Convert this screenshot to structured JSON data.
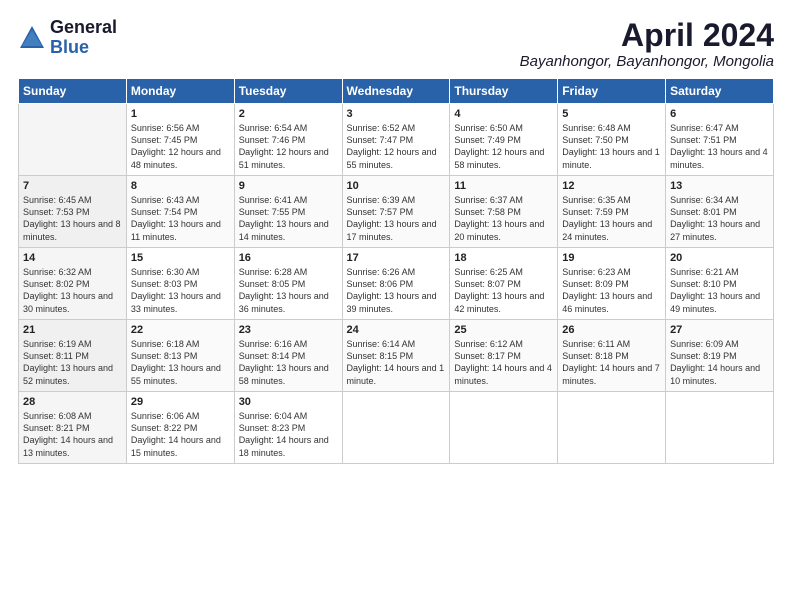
{
  "logo": {
    "general": "General",
    "blue": "Blue"
  },
  "title": "April 2024",
  "location": "Bayanhongor, Bayanhongor, Mongolia",
  "headers": [
    "Sunday",
    "Monday",
    "Tuesday",
    "Wednesday",
    "Thursday",
    "Friday",
    "Saturday"
  ],
  "weeks": [
    [
      {
        "day": "",
        "content": ""
      },
      {
        "day": "1",
        "content": "Sunrise: 6:56 AM\nSunset: 7:45 PM\nDaylight: 12 hours\nand 48 minutes."
      },
      {
        "day": "2",
        "content": "Sunrise: 6:54 AM\nSunset: 7:46 PM\nDaylight: 12 hours\nand 51 minutes."
      },
      {
        "day": "3",
        "content": "Sunrise: 6:52 AM\nSunset: 7:47 PM\nDaylight: 12 hours\nand 55 minutes."
      },
      {
        "day": "4",
        "content": "Sunrise: 6:50 AM\nSunset: 7:49 PM\nDaylight: 12 hours\nand 58 minutes."
      },
      {
        "day": "5",
        "content": "Sunrise: 6:48 AM\nSunset: 7:50 PM\nDaylight: 13 hours\nand 1 minute."
      },
      {
        "day": "6",
        "content": "Sunrise: 6:47 AM\nSunset: 7:51 PM\nDaylight: 13 hours\nand 4 minutes."
      }
    ],
    [
      {
        "day": "7",
        "content": "Sunrise: 6:45 AM\nSunset: 7:53 PM\nDaylight: 13 hours\nand 8 minutes."
      },
      {
        "day": "8",
        "content": "Sunrise: 6:43 AM\nSunset: 7:54 PM\nDaylight: 13 hours\nand 11 minutes."
      },
      {
        "day": "9",
        "content": "Sunrise: 6:41 AM\nSunset: 7:55 PM\nDaylight: 13 hours\nand 14 minutes."
      },
      {
        "day": "10",
        "content": "Sunrise: 6:39 AM\nSunset: 7:57 PM\nDaylight: 13 hours\nand 17 minutes."
      },
      {
        "day": "11",
        "content": "Sunrise: 6:37 AM\nSunset: 7:58 PM\nDaylight: 13 hours\nand 20 minutes."
      },
      {
        "day": "12",
        "content": "Sunrise: 6:35 AM\nSunset: 7:59 PM\nDaylight: 13 hours\nand 24 minutes."
      },
      {
        "day": "13",
        "content": "Sunrise: 6:34 AM\nSunset: 8:01 PM\nDaylight: 13 hours\nand 27 minutes."
      }
    ],
    [
      {
        "day": "14",
        "content": "Sunrise: 6:32 AM\nSunset: 8:02 PM\nDaylight: 13 hours\nand 30 minutes."
      },
      {
        "day": "15",
        "content": "Sunrise: 6:30 AM\nSunset: 8:03 PM\nDaylight: 13 hours\nand 33 minutes."
      },
      {
        "day": "16",
        "content": "Sunrise: 6:28 AM\nSunset: 8:05 PM\nDaylight: 13 hours\nand 36 minutes."
      },
      {
        "day": "17",
        "content": "Sunrise: 6:26 AM\nSunset: 8:06 PM\nDaylight: 13 hours\nand 39 minutes."
      },
      {
        "day": "18",
        "content": "Sunrise: 6:25 AM\nSunset: 8:07 PM\nDaylight: 13 hours\nand 42 minutes."
      },
      {
        "day": "19",
        "content": "Sunrise: 6:23 AM\nSunset: 8:09 PM\nDaylight: 13 hours\nand 46 minutes."
      },
      {
        "day": "20",
        "content": "Sunrise: 6:21 AM\nSunset: 8:10 PM\nDaylight: 13 hours\nand 49 minutes."
      }
    ],
    [
      {
        "day": "21",
        "content": "Sunrise: 6:19 AM\nSunset: 8:11 PM\nDaylight: 13 hours\nand 52 minutes."
      },
      {
        "day": "22",
        "content": "Sunrise: 6:18 AM\nSunset: 8:13 PM\nDaylight: 13 hours\nand 55 minutes."
      },
      {
        "day": "23",
        "content": "Sunrise: 6:16 AM\nSunset: 8:14 PM\nDaylight: 13 hours\nand 58 minutes."
      },
      {
        "day": "24",
        "content": "Sunrise: 6:14 AM\nSunset: 8:15 PM\nDaylight: 14 hours\nand 1 minute."
      },
      {
        "day": "25",
        "content": "Sunrise: 6:12 AM\nSunset: 8:17 PM\nDaylight: 14 hours\nand 4 minutes."
      },
      {
        "day": "26",
        "content": "Sunrise: 6:11 AM\nSunset: 8:18 PM\nDaylight: 14 hours\nand 7 minutes."
      },
      {
        "day": "27",
        "content": "Sunrise: 6:09 AM\nSunset: 8:19 PM\nDaylight: 14 hours\nand 10 minutes."
      }
    ],
    [
      {
        "day": "28",
        "content": "Sunrise: 6:08 AM\nSunset: 8:21 PM\nDaylight: 14 hours\nand 13 minutes."
      },
      {
        "day": "29",
        "content": "Sunrise: 6:06 AM\nSunset: 8:22 PM\nDaylight: 14 hours\nand 15 minutes."
      },
      {
        "day": "30",
        "content": "Sunrise: 6:04 AM\nSunset: 8:23 PM\nDaylight: 14 hours\nand 18 minutes."
      },
      {
        "day": "",
        "content": ""
      },
      {
        "day": "",
        "content": ""
      },
      {
        "day": "",
        "content": ""
      },
      {
        "day": "",
        "content": ""
      }
    ]
  ]
}
